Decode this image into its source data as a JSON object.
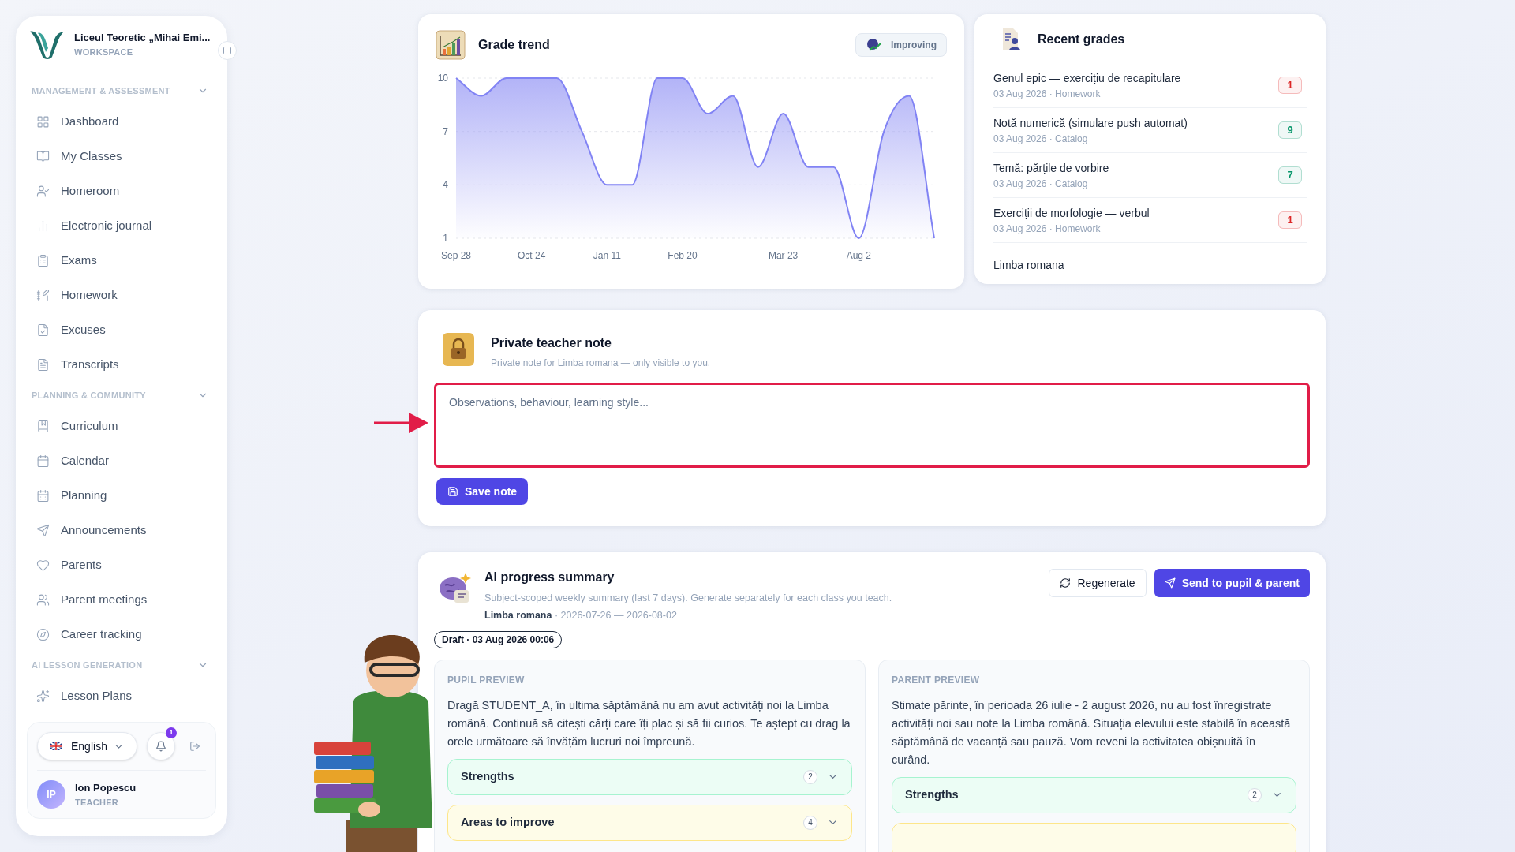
{
  "sidebar": {
    "school": "Liceul Teoretic „Mihai Emi...",
    "workspace_label": "WORKSPACE",
    "sections": [
      {
        "title": "MANAGEMENT & ASSESSMENT",
        "expanded": true,
        "items": [
          {
            "label": "Dashboard"
          },
          {
            "label": "My Classes"
          },
          {
            "label": "Homeroom"
          },
          {
            "label": "Electronic journal"
          },
          {
            "label": "Exams"
          },
          {
            "label": "Homework"
          },
          {
            "label": "Excuses"
          },
          {
            "label": "Transcripts"
          }
        ]
      },
      {
        "title": "PLANNING & COMMUNITY",
        "expanded": true,
        "items": [
          {
            "label": "Curriculum"
          },
          {
            "label": "Calendar"
          },
          {
            "label": "Planning"
          },
          {
            "label": "Announcements"
          },
          {
            "label": "Parents"
          },
          {
            "label": "Parent meetings"
          },
          {
            "label": "Career tracking"
          }
        ]
      },
      {
        "title": "AI LESSON GENERATION",
        "expanded": true,
        "items": [
          {
            "label": "Lesson Plans"
          }
        ]
      }
    ],
    "footer": {
      "language": "English",
      "notifications": "1",
      "user": {
        "initials": "IP",
        "name": "Ion Popescu",
        "role": "TEACHER"
      }
    }
  },
  "grade_trend": {
    "title": "Grade trend",
    "status": "Improving",
    "chart_data": {
      "type": "area",
      "categories": [
        "Sep 28",
        null,
        null,
        "Oct 24",
        null,
        null,
        "Jan 11",
        null,
        null,
        "Feb 20",
        null,
        null,
        null,
        "Mar 23",
        null,
        null,
        "Aug 2",
        null,
        null,
        null
      ],
      "series": [
        {
          "color": "#8183f4",
          "values": [
            10,
            9,
            10,
            10,
            10,
            7,
            4,
            4,
            10,
            10,
            8,
            9,
            5,
            8,
            5,
            5,
            1,
            7,
            9,
            1
          ]
        }
      ],
      "ylim": [
        1,
        10
      ],
      "yticks": [
        1,
        4,
        7,
        10
      ]
    }
  },
  "recent_grades": {
    "title": "Recent grades",
    "items": [
      {
        "title": "Genul epic — exercițiu de recapitulare",
        "meta": "03 Aug 2026 · Homework",
        "grade": "1",
        "color": "#dc2626"
      },
      {
        "title": "Notă numerică (simulare push automat)",
        "meta": "03 Aug 2026 · Catalog",
        "grade": "9",
        "color": "#059669"
      },
      {
        "title": "Temă: părțile de vorbire",
        "meta": "03 Aug 2026 · Catalog",
        "grade": "7",
        "color": "#059669"
      },
      {
        "title": "Exerciții de morfologie — verbul",
        "meta": "03 Aug 2026 · Homework",
        "grade": "1",
        "color": "#dc2626"
      },
      {
        "title": "Limba romana"
      }
    ]
  },
  "teacher_note": {
    "title": "Private teacher note",
    "subtitle": "Private note for Limba romana — only visible to you.",
    "placeholder": "Observations, behaviour, learning style...",
    "highlighted": true,
    "save_button": "Save note"
  },
  "ai_summary": {
    "title": "AI progress summary",
    "description": "Subject-scoped weekly summary (last 7 days). Generate separately for each class you teach.",
    "subject_line": "**Limba romana** · 2026-07-26 — 2026-08-02",
    "regenerate_button": "Regenerate",
    "send_button": "Send to pupil & parent",
    "draft": "Draft · 03 Aug 2026 00:06",
    "previews": [
      {
        "heading": "PUPIL PREVIEW",
        "text": "Dragă STUDENT_A, în ultima săptămână nu am avut activități noi la Limba română. Continuă să citești cărți care îți plac și să fii curios. Te aștept cu drag la orele următoare să învățăm lucruri noi împreună.",
        "sections": [
          {
            "kind": "strengths",
            "label": "Strengths",
            "count": "2",
            "expanded": false
          },
          {
            "kind": "improve",
            "label": "Areas to improve",
            "count": "4",
            "expanded": false
          }
        ]
      },
      {
        "heading": "PARENT PREVIEW",
        "text": "Stimate părinte, în perioada 26 iulie - 2 august 2026, nu au fost înregistrate activități noi sau note la Limba română. Situația elevului este stabilă în această săptămână de vacanță sau pauză. Vom reveni la activitatea obișnuită în curând.",
        "sections": [
          {
            "kind": "strengths",
            "label": "Strengths",
            "count": "2",
            "expanded": false
          },
          {
            "kind": "improve"
          }
        ]
      }
    ]
  }
}
